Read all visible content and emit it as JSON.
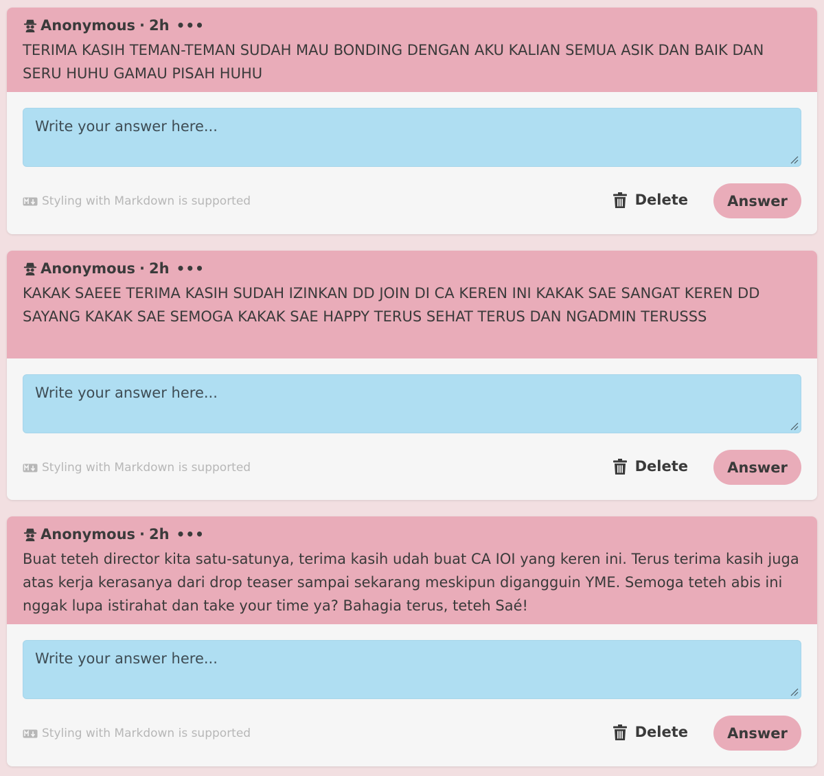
{
  "questions": [
    {
      "author": "Anonymous",
      "time": "2h",
      "more": "•••",
      "text": "TERIMA KASIH TEMAN-TEMAN SUDAH MAU BONDING DENGAN AKU KALIAN SEMUA ASIK DAN BAIK DAN SERU HUHU GAMAU PISAH HUHU",
      "placeholder": "Write your answer here...",
      "markdown_note": "Styling with Markdown is supported",
      "delete_label": "Delete",
      "answer_label": "Answer"
    },
    {
      "author": "Anonymous",
      "time": "2h",
      "more": "•••",
      "text": "KAKAK SAEEE TERIMA KASIH SUDAH IZINKAN DD JOIN DI CA KEREN INI KAKAK SAE SANGAT KEREN DD SAYANG KAKAK SAE SEMOGA KAKAK SAE HAPPY TERUS SEHAT TERUS DAN NGADMIN TERUSSS",
      "placeholder": "Write your answer here...",
      "markdown_note": "Styling with Markdown is supported",
      "delete_label": "Delete",
      "answer_label": "Answer"
    },
    {
      "author": "Anonymous",
      "time": "2h",
      "more": "•••",
      "text": "Buat teteh director kita satu-satunya, terima kasih udah buat CA IOI yang keren ini. Terus terima kasih juga atas kerja kerasanya dari drop teaser sampai sekarang meskipun digangguin YME. Semoga teteh abis ini nggak lupa istirahat dan take your time ya? Bahagia terus, teteh Saé!",
      "placeholder": "Write your answer here...",
      "markdown_note": "Styling with Markdown is supported",
      "delete_label": "Delete",
      "answer_label": "Answer"
    }
  ],
  "icons": {
    "author": "spy-icon",
    "markdown": "markdown-icon",
    "delete": "trash-icon"
  },
  "colors": {
    "background": "#f2dfe1",
    "question_header": "#e9acb9",
    "card": "#f6f6f6",
    "answer_box": "#afdef2",
    "answer_button": "#e9acb9",
    "muted_text": "#b7b7b7"
  }
}
